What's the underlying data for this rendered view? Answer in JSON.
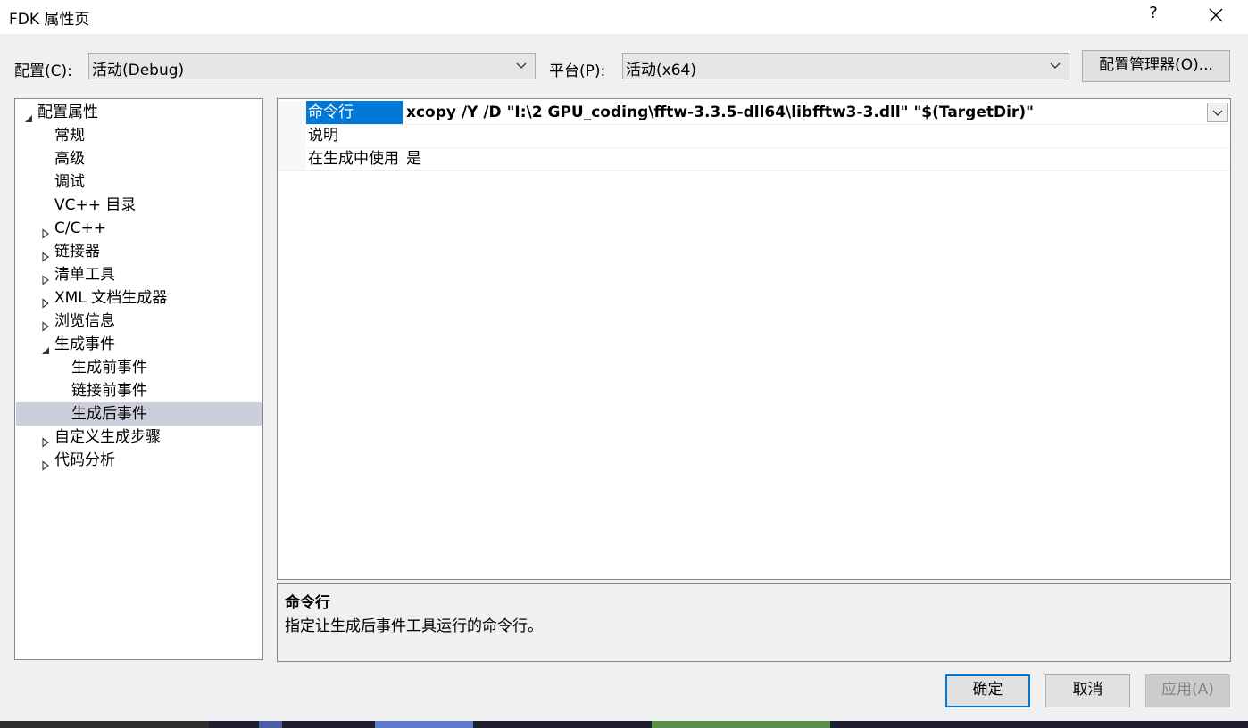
{
  "window": {
    "title": "FDK 属性页",
    "help_label": "?",
    "close_icon": "close-icon"
  },
  "toolbar": {
    "config_label": "配置(C):",
    "config_value": "活动(Debug)",
    "platform_label": "平台(P):",
    "platform_value": "活动(x64)",
    "config_manager_label": "配置管理器(O)..."
  },
  "tree": {
    "items": [
      {
        "label": "配置属性",
        "expander": "expanded"
      },
      {
        "label": "常规",
        "expander": "none"
      },
      {
        "label": "高级",
        "expander": "none"
      },
      {
        "label": "调试",
        "expander": "none"
      },
      {
        "label": "VC++ 目录",
        "expander": "none"
      },
      {
        "label": "C/C++",
        "expander": "collapsed"
      },
      {
        "label": "链接器",
        "expander": "collapsed"
      },
      {
        "label": "清单工具",
        "expander": "collapsed"
      },
      {
        "label": "XML 文档生成器",
        "expander": "collapsed"
      },
      {
        "label": "浏览信息",
        "expander": "collapsed"
      },
      {
        "label": "生成事件",
        "expander": "expanded"
      },
      {
        "label": "生成前事件",
        "expander": "none"
      },
      {
        "label": "链接前事件",
        "expander": "none"
      },
      {
        "label": "生成后事件",
        "expander": "none",
        "selected": true
      },
      {
        "label": "自定义生成步骤",
        "expander": "collapsed"
      },
      {
        "label": "代码分析",
        "expander": "collapsed"
      }
    ]
  },
  "properties": {
    "rows": [
      {
        "name": "命令行",
        "value": "xcopy /Y /D \"I:\\2 GPU_coding\\fftw-3.3.5-dll64\\libfftw3-3.dll\"  \"$(TargetDir)\"",
        "selected": true,
        "bold": true
      },
      {
        "name": "说明",
        "value": ""
      },
      {
        "name": "在生成中使用",
        "value": "是"
      }
    ]
  },
  "description": {
    "heading": "命令行",
    "body": "指定让生成后事件工具运行的命令行。"
  },
  "buttons": {
    "ok": "确定",
    "cancel": "取消",
    "apply": "应用(A)"
  },
  "colors": {
    "accent": "#0078d7",
    "tree_selection": "#cccedb"
  }
}
